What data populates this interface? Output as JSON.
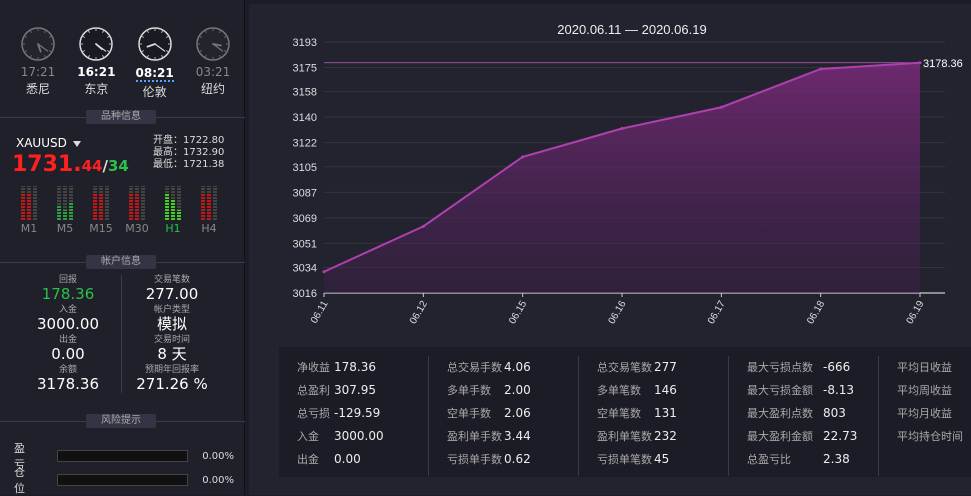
{
  "clocks": [
    {
      "time": "17:21",
      "city": "悉尼",
      "active": false,
      "h": 17,
      "m": 21
    },
    {
      "time": "16:21",
      "city": "东京",
      "active": true,
      "h": 16,
      "m": 21
    },
    {
      "time": "08:21",
      "city": "伦敦",
      "active": true,
      "h": 8,
      "m": 21
    },
    {
      "time": "03:21",
      "city": "纽约",
      "active": false,
      "h": 3,
      "m": 21
    }
  ],
  "sections": {
    "symbol_info": "品种信息",
    "account_info": "帐户信息",
    "risk": "风险提示"
  },
  "symbol": {
    "name": "XAUUSD",
    "price_big": "1731.",
    "price_small": "44",
    "price_slash": "/",
    "price_ask": "34",
    "open": "开盘：1722.80",
    "high": "最高：1732.90",
    "low": "最低：1721.38"
  },
  "meters": [
    {
      "label": "M1",
      "levels": [
        0.8,
        0.8,
        0.0
      ],
      "color": "#c01818",
      "on": false
    },
    {
      "label": "M5",
      "levels": [
        0.4,
        0.3,
        0.5
      ],
      "color": "#2aa040",
      "on": false
    },
    {
      "label": "M15",
      "levels": [
        0.8,
        0.8,
        0.0
      ],
      "color": "#c01818",
      "on": false
    },
    {
      "label": "M30",
      "levels": [
        0.8,
        0.8,
        0.0
      ],
      "color": "#c01818",
      "on": false
    },
    {
      "label": "H1",
      "levels": [
        0.8,
        0.6,
        0.3
      ],
      "color": "#44d022",
      "on": true
    },
    {
      "label": "H4",
      "levels": [
        0.8,
        0.8,
        0.0
      ],
      "color": "#c01818",
      "on": false
    }
  ],
  "account": {
    "return_label": "回报",
    "return_value": "178.36",
    "trades_label": "交易笔数",
    "trades_value": "277.00",
    "deposit_label": "入金",
    "deposit_value": "3000.00",
    "type_label": "帐户类型",
    "type_value": "模拟",
    "withdraw_label": "出金",
    "withdraw_value": "0.00",
    "time_label": "交易时间",
    "time_value": "8 天",
    "balance_label": "余额",
    "balance_value": "3178.36",
    "annual_label": "预期年回报率",
    "annual_value": "271.26 %"
  },
  "risk": {
    "pl_label": "盈 亏",
    "pl_pct": "0.00%",
    "pl_fill": 0,
    "pos_label": "仓 位",
    "pos_pct": "0.00%",
    "pos_fill": 0
  },
  "chart_data": {
    "type": "area",
    "title": "2020.06.11 — 2020.06.19",
    "categories": [
      "06.11",
      "06.12",
      "06.15",
      "06.16",
      "06.17",
      "06.18",
      "06.19"
    ],
    "values": [
      3031,
      3063,
      3112,
      3132,
      3147,
      3174,
      3178.36
    ],
    "yticks": [
      "3193",
      "3175",
      "3158",
      "3140",
      "3122",
      "3105",
      "3087",
      "3069",
      "3051",
      "3034",
      "3016"
    ],
    "ylim": [
      3016,
      3193
    ],
    "last_label": "3178.36",
    "color": "#b040b0"
  },
  "stats": [
    [
      [
        "净收益",
        "178.36"
      ],
      [
        "总盈利",
        "307.95"
      ],
      [
        "总亏损",
        "-129.59"
      ],
      [
        "入金",
        "3000.00"
      ],
      [
        "出金",
        "0.00"
      ]
    ],
    [
      [
        "总交易手数",
        "4.06"
      ],
      [
        "多单手数",
        "2.00"
      ],
      [
        "空单手数",
        "2.06"
      ],
      [
        "盈利单手数",
        "3.44"
      ],
      [
        "亏损单手数",
        "0.62"
      ]
    ],
    [
      [
        "总交易笔数",
        "277"
      ],
      [
        "多单笔数",
        "146"
      ],
      [
        "空单笔数",
        "131"
      ],
      [
        "盈利单笔数",
        "232"
      ],
      [
        "亏损单笔数",
        "45"
      ]
    ],
    [
      [
        "最大亏损点数",
        "-666"
      ],
      [
        "最大亏损金额",
        "-8.13"
      ],
      [
        "最大盈利点数",
        "803"
      ],
      [
        "最大盈利金额",
        "22.73"
      ],
      [
        "总盈亏比",
        "2.38"
      ]
    ],
    [
      [
        "平均日收益",
        ""
      ],
      [
        "平均周收益",
        ""
      ],
      [
        "平均月收益",
        ""
      ],
      [
        "平均持仓时间",
        ""
      ]
    ]
  ]
}
